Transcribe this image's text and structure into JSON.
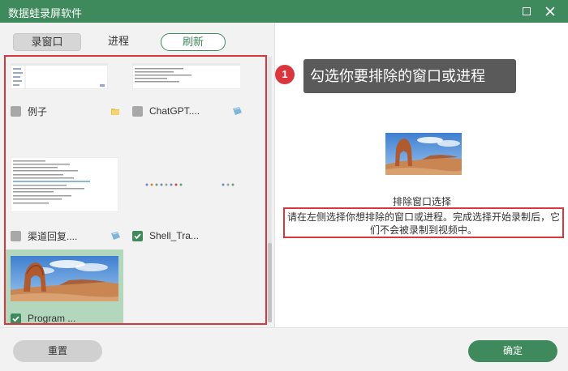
{
  "window": {
    "title": "数据蛙录屏软件",
    "icons": {
      "maximize": "maximize-icon",
      "close": "close-icon"
    }
  },
  "tabs": [
    {
      "label": "录窗口",
      "active": true
    },
    {
      "label": "进程",
      "active": false
    },
    {
      "label": "刷新",
      "active": false
    }
  ],
  "windows": [
    {
      "label": "例子",
      "checked": false,
      "app_icon": "folder-icon",
      "thumb": "file-explorer"
    },
    {
      "label": "ChatGPT....",
      "checked": false,
      "app_icon": "notepad-icon",
      "thumb": "text-editor"
    },
    {
      "label": "渠道回复....",
      "checked": false,
      "app_icon": "notepad-icon",
      "thumb": "document"
    },
    {
      "label": "Shell_Tra...",
      "checked": true,
      "app_icon": "",
      "thumb": "tray"
    },
    {
      "label": "Program ...",
      "checked": true,
      "app_icon": "",
      "thumb": "desert-arch",
      "selected": true
    }
  ],
  "tip": {
    "badge": "1",
    "text": "勾选你要排除的窗口或进程"
  },
  "preview": {
    "title": "排除窗口选择",
    "description": "请在左侧选择你想排除的窗口或进程。完成选择开始录制后，它们不会被录制到视频中。"
  },
  "footer": {
    "reset_label": "重置",
    "ok_label": "确定"
  },
  "colors": {
    "accent": "#3e8a5c",
    "highlight": "#d9363e",
    "selected_bg": "#b3d7bc"
  }
}
